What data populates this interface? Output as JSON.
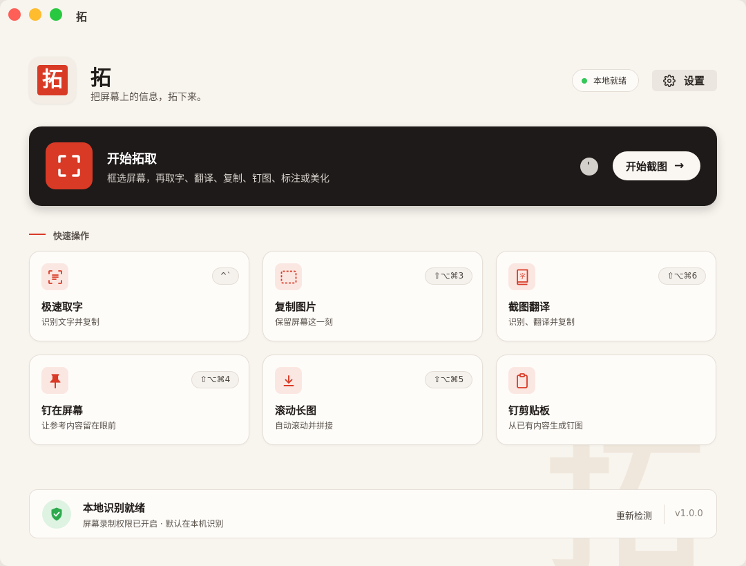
{
  "window": {
    "title": "拓"
  },
  "header": {
    "logo_char": "拓",
    "app_name": "拓",
    "tagline": "把屏幕上的信息，拓下来。",
    "status_label": "本地就绪",
    "settings_label": "设置"
  },
  "hero": {
    "title": "开始拓取",
    "subtitle": "框选屏幕，再取字、翻译、复制、钉图、标注或美化",
    "button_label": "开始截图",
    "button_arrow": "→"
  },
  "section": {
    "title": "快速操作"
  },
  "cards": [
    {
      "title": "极速取字",
      "desc": "识别文字并复制",
      "shortcut": "^`",
      "icon": "text-scan-icon"
    },
    {
      "title": "复制图片",
      "desc": "保留屏幕这一刻",
      "shortcut": "⇧⌥⌘3",
      "icon": "dashed-rect-icon"
    },
    {
      "title": "截图翻译",
      "desc": "识别、翻译并复制",
      "shortcut": "⇧⌥⌘6",
      "icon": "dictionary-icon"
    },
    {
      "title": "钉在屏幕",
      "desc": "让参考内容留在眼前",
      "shortcut": "⇧⌥⌘4",
      "icon": "pin-icon"
    },
    {
      "title": "滚动长图",
      "desc": "自动滚动并拼接",
      "shortcut": "⇧⌥⌘5",
      "icon": "download-arrow-icon"
    },
    {
      "title": "钉剪贴板",
      "desc": "从已有内容生成钉图",
      "shortcut": "",
      "icon": "clipboard-icon"
    }
  ],
  "footer": {
    "title": "本地识别就绪",
    "subtitle": "屏幕录制权限已开启 · 默认在本机识别",
    "recheck_label": "重新检测",
    "version": "v1.0.0"
  },
  "colors": {
    "accent": "#d93a26",
    "background": "#f8f4ee",
    "hero_bg": "#1d1a19",
    "status_green": "#34c759"
  }
}
